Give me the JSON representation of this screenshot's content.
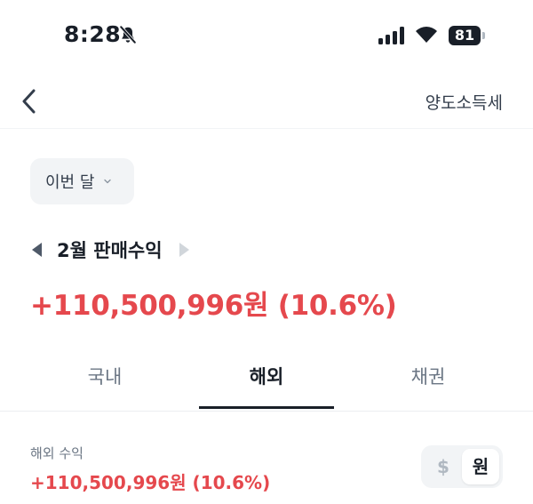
{
  "status_bar": {
    "time": "8:28",
    "battery": "81"
  },
  "nav": {
    "right_link": "양도소득세"
  },
  "period_filter": {
    "label": "이번 달"
  },
  "summary": {
    "month_label": "2월 판매수익",
    "profit": "+110,500,996원 (10.6%)"
  },
  "tabs": [
    {
      "label": "국내"
    },
    {
      "label": "해외"
    },
    {
      "label": "채권"
    }
  ],
  "active_tab": "해외",
  "overseas": {
    "label": "해외 수익",
    "profit": "+110,500,996원 (10.6%)"
  },
  "currency_toggle": {
    "options": [
      "$",
      "원"
    ],
    "selected": "원"
  },
  "colors": {
    "profit": "#e5484d",
    "text": "#191f28",
    "muted": "#6b7684",
    "surface": "#f2f4f6"
  }
}
